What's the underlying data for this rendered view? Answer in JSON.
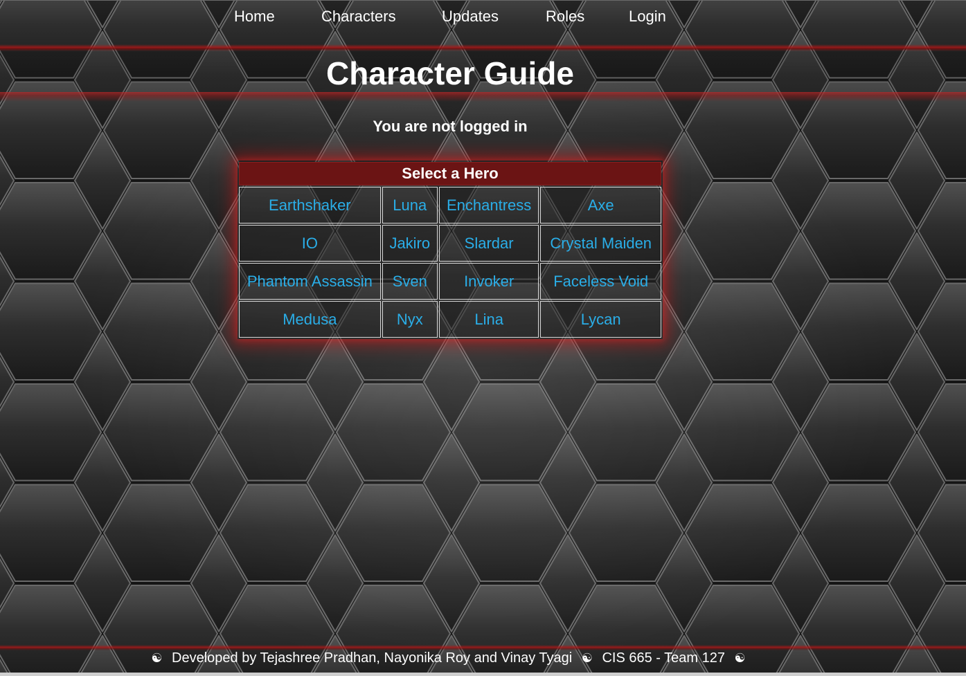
{
  "nav": {
    "items": [
      {
        "label": "Home"
      },
      {
        "label": "Characters"
      },
      {
        "label": "Updates"
      },
      {
        "label": "Roles"
      },
      {
        "label": "Login"
      }
    ]
  },
  "header": {
    "title": "Character Guide"
  },
  "status": {
    "login_text": "You are not logged in"
  },
  "hero_table": {
    "caption": "Select a Hero",
    "rows": [
      [
        "Earthshaker",
        "Luna",
        "Enchantress",
        "Axe"
      ],
      [
        "IO",
        "Jakiro",
        "Slardar",
        "Crystal Maiden"
      ],
      [
        "Phantom Assassin",
        "Sven",
        "Invoker",
        "Faceless Void"
      ],
      [
        "Medusa",
        "Nyx",
        "Lina",
        "Lycan"
      ]
    ]
  },
  "footer": {
    "symbol": "☯",
    "credits": "Developed by Tejashree Pradhan, Nayonika Roy and Vinay Tyagi",
    "course": "CIS 665 - Team 127"
  },
  "colors": {
    "accent_red": "#6b1414",
    "link_blue": "#2aaee8",
    "glow_red": "#c81414"
  }
}
